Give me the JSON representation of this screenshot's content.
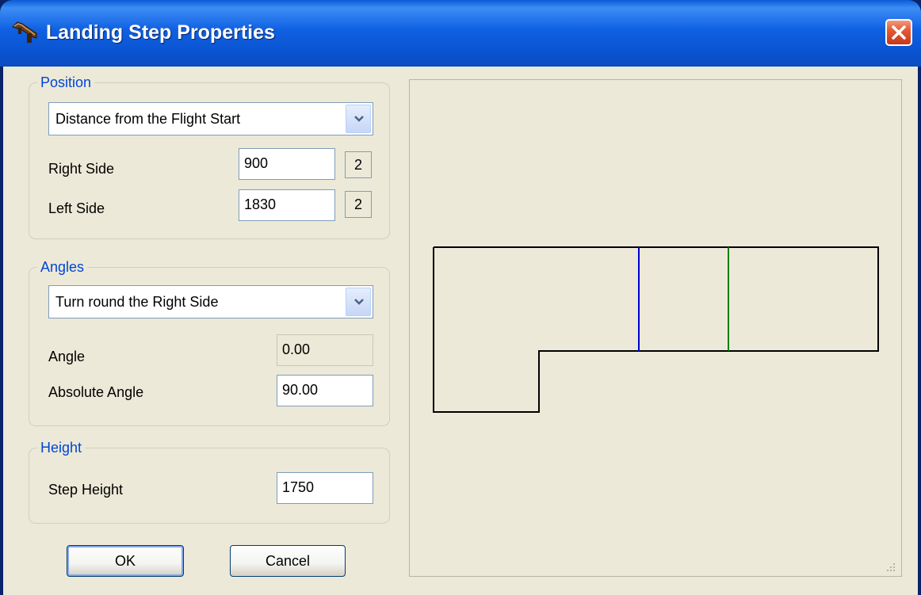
{
  "window": {
    "title": "Landing Step Properties",
    "icons": {
      "app": "stair-icon",
      "close": "close-icon"
    }
  },
  "position_group": {
    "label": "Position",
    "mode_selected": "Distance from the Flight Start",
    "right_side_label": "Right Side",
    "right_side_value": "900",
    "right_side_button": "2",
    "left_side_label": "Left Side",
    "left_side_value": "1830",
    "left_side_button": "2"
  },
  "angles_group": {
    "label": "Angles",
    "mode_selected": "Turn round the Right Side",
    "angle_label": "Angle",
    "angle_value": "0.00",
    "absolute_angle_label": "Absolute Angle",
    "absolute_angle_value": "90.00"
  },
  "height_group": {
    "label": "Height",
    "step_height_label": "Step Height",
    "step_height_value": "1750"
  },
  "buttons": {
    "ok": "OK",
    "cancel": "Cancel"
  },
  "colors": {
    "outline": "#000000",
    "right_side_marker": "#0000d0",
    "left_side_marker": "#008000"
  }
}
